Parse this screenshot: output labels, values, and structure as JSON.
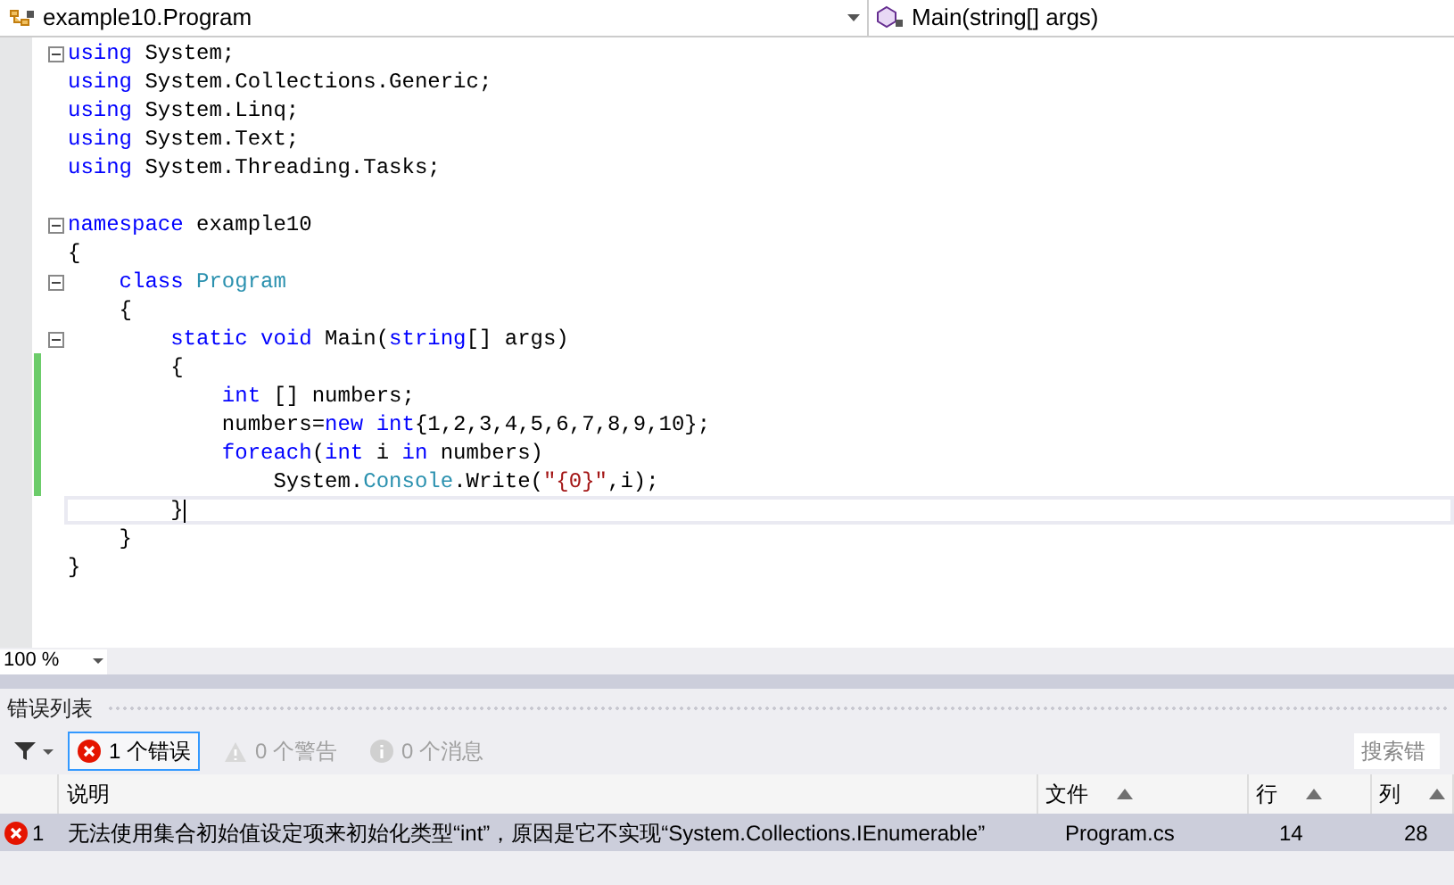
{
  "navbar": {
    "type_selector": "example10.Program",
    "member_selector": "Main(string[] args)"
  },
  "editor": {
    "lines": [
      {
        "fold": true,
        "changed": false,
        "current": false,
        "tokens": [
          {
            "kind": "kw",
            "text": "using"
          },
          {
            "kind": "plain",
            "text": " System;"
          }
        ]
      },
      {
        "fold": false,
        "changed": false,
        "current": false,
        "tokens": [
          {
            "kind": "kw",
            "text": "using"
          },
          {
            "kind": "plain",
            "text": " System.Collections.Generic;"
          }
        ]
      },
      {
        "fold": false,
        "changed": false,
        "current": false,
        "tokens": [
          {
            "kind": "kw",
            "text": "using"
          },
          {
            "kind": "plain",
            "text": " System.Linq;"
          }
        ]
      },
      {
        "fold": false,
        "changed": false,
        "current": false,
        "tokens": [
          {
            "kind": "kw",
            "text": "using"
          },
          {
            "kind": "plain",
            "text": " System.Text;"
          }
        ]
      },
      {
        "fold": false,
        "changed": false,
        "current": false,
        "tokens": [
          {
            "kind": "kw",
            "text": "using"
          },
          {
            "kind": "plain",
            "text": " System.Threading.Tasks;"
          }
        ]
      },
      {
        "fold": false,
        "changed": false,
        "current": false
      },
      {
        "fold": true,
        "changed": false,
        "current": false,
        "tokens": [
          {
            "kind": "kw",
            "text": "namespace"
          },
          {
            "kind": "plain",
            "text": " example10"
          }
        ]
      },
      {
        "fold": false,
        "changed": false,
        "current": false,
        "tokens": [
          {
            "kind": "plain",
            "text": "{"
          }
        ]
      },
      {
        "fold": true,
        "changed": false,
        "current": false,
        "tokens": [
          {
            "kind": "kw",
            "text": "    class"
          },
          {
            "kind": "type",
            "text": " Program"
          }
        ]
      },
      {
        "fold": false,
        "changed": false,
        "current": false,
        "tokens": [
          {
            "kind": "plain",
            "text": "    {"
          }
        ]
      },
      {
        "fold": true,
        "changed": false,
        "current": false,
        "tokens": [
          {
            "kind": "kw",
            "text": "        static void"
          },
          {
            "kind": "plain",
            "text": " Main("
          },
          {
            "kind": "kw",
            "text": "string"
          },
          {
            "kind": "plain",
            "text": "[] args)"
          }
        ]
      },
      {
        "fold": false,
        "changed": true,
        "current": false,
        "tokens": [
          {
            "kind": "plain",
            "text": "        {"
          }
        ]
      },
      {
        "fold": false,
        "changed": true,
        "current": false,
        "tokens": [
          {
            "kind": "kw",
            "text": "            int"
          },
          {
            "kind": "plain",
            "text": " [] numbers;"
          }
        ]
      },
      {
        "fold": false,
        "changed": true,
        "current": false,
        "tokens": [
          {
            "kind": "plain",
            "text": "            numbers="
          },
          {
            "kind": "kw",
            "text": "new int"
          },
          {
            "kind": "plain",
            "text": "{1,2,3,4,5,6,7,8,9,10};"
          }
        ]
      },
      {
        "fold": false,
        "changed": true,
        "current": false,
        "tokens": [
          {
            "kind": "kw",
            "text": "            foreach"
          },
          {
            "kind": "plain",
            "text": "("
          },
          {
            "kind": "kw",
            "text": "int"
          },
          {
            "kind": "plain",
            "text": " i "
          },
          {
            "kind": "kw",
            "text": "in"
          },
          {
            "kind": "plain",
            "text": " numbers)"
          }
        ]
      },
      {
        "fold": false,
        "changed": true,
        "current": false,
        "tokens": [
          {
            "kind": "plain",
            "text": "                System."
          },
          {
            "kind": "type",
            "text": "Console"
          },
          {
            "kind": "plain",
            "text": ".Write("
          },
          {
            "kind": "str",
            "text": "\"{0}\""
          },
          {
            "kind": "plain",
            "text": ",i);"
          }
        ]
      },
      {
        "fold": false,
        "changed": false,
        "current": true,
        "tokens": [
          {
            "kind": "plain",
            "text": "        }"
          }
        ]
      },
      {
        "fold": false,
        "changed": false,
        "current": false,
        "tokens": [
          {
            "kind": "plain",
            "text": "    }"
          }
        ]
      },
      {
        "fold": false,
        "changed": false,
        "current": false,
        "tokens": [
          {
            "kind": "plain",
            "text": "}"
          }
        ]
      }
    ],
    "zoom": "100 %"
  },
  "error_list": {
    "title": "错误列表",
    "filters": [
      {
        "kind": "error",
        "label": "1 个错误",
        "selected": true
      },
      {
        "kind": "warning",
        "label": "0 个警告",
        "selected": false
      },
      {
        "kind": "message",
        "label": "0 个消息",
        "selected": false
      }
    ],
    "search": {
      "placeholder": "搜索错"
    },
    "columns": [
      {
        "label": "说明",
        "sorted": false
      },
      {
        "label": "文件",
        "sorted": true
      },
      {
        "label": "行",
        "sorted": true
      },
      {
        "label": "列",
        "sorted": true
      }
    ],
    "rows": [
      {
        "index": "1",
        "description": "无法使用集合初始值设定项来初始化类型“int”，原因是它不实现“System.Collections.IEnumerable”",
        "file": "Program.cs",
        "line": "14",
        "column": "28",
        "selected": true
      }
    ]
  }
}
